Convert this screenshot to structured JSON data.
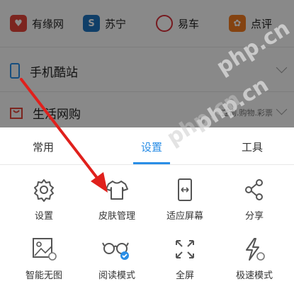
{
  "quick_links": [
    {
      "label": "有缘网",
      "icon": "heart-icon",
      "color": "#e2443a"
    },
    {
      "label": "苏宁",
      "icon": "suning-icon",
      "color": "#1e73be"
    },
    {
      "label": "易车",
      "icon": "yiche-icon",
      "color": "#d8303a"
    },
    {
      "label": "点评",
      "icon": "dianping-icon",
      "color": "#f07a1f"
    }
  ],
  "bg_rows": [
    {
      "label": "手机酷站",
      "icon": "phone-icon",
      "sub": ""
    },
    {
      "label": "生活网购",
      "icon": "shopping-bag-icon",
      "sub": "查询.购物.彩票"
    }
  ],
  "tabs": [
    {
      "label": "常用"
    },
    {
      "label": "设置"
    },
    {
      "label": "工具"
    }
  ],
  "active_tab": "设置",
  "settings_items": [
    {
      "label": "设置",
      "icon": "gear-icon"
    },
    {
      "label": "皮肤管理",
      "icon": "tshirt-icon"
    },
    {
      "label": "适应屏幕",
      "icon": "fit-screen-icon"
    },
    {
      "label": "分享",
      "icon": "share-icon"
    },
    {
      "label": "智能无图",
      "icon": "image-icon"
    },
    {
      "label": "阅读模式",
      "icon": "glasses-icon"
    },
    {
      "label": "全屏",
      "icon": "fullscreen-icon"
    },
    {
      "label": "极速模式",
      "icon": "lightning-icon"
    }
  ],
  "watermark": "php.cn",
  "accent_color": "#2a8ee6",
  "annotation_arrow_color": "#e0201c"
}
